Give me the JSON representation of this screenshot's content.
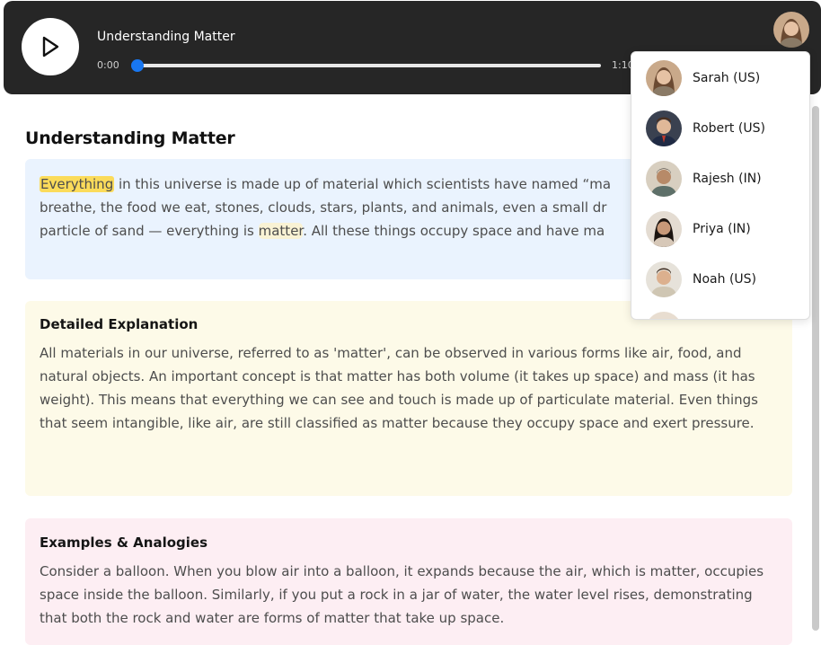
{
  "player": {
    "title": "Understanding Matter",
    "time_current": "0:00",
    "time_total": "1:10",
    "progress": 0
  },
  "page": {
    "title": "Understanding Matter"
  },
  "intro": {
    "highlighted_word": "Everything",
    "line1_rest": " in this universe is made up of material which scientists have named “ma",
    "line2": "breathe, the food we eat, stones, clouds, stars, plants, and animals, even a small dr",
    "line3_a": "particle of sand — everything is ",
    "line3_word": "matter",
    "line3_b": ". All these things occupy space and have ma"
  },
  "detail": {
    "heading": "Detailed Explanation",
    "body": "All materials in our universe, referred to as 'matter', can be observed in various forms like air, food, and natural objects. An important concept is that matter has both volume (it takes up space) and mass (it has weight). This means that everything we can see and touch is made up of particulate material. Even things that seem intangible, like air, are still classified as matter because they occupy space and exert pressure."
  },
  "examples": {
    "heading": "Examples & Analogies",
    "body": "Consider a balloon. When you blow air into a balloon, it expands because the air, which is matter, occupies space inside the balloon. Similarly, if you put a rock in a jar of water, the water level rises, demonstrating that both the rock and water are forms of matter that take up space."
  },
  "voices": [
    {
      "name": "Sarah (US)",
      "icon": "avatar-sarah-icon"
    },
    {
      "name": "Robert (US)",
      "icon": "avatar-robert-icon"
    },
    {
      "name": "Rajesh (IN)",
      "icon": "avatar-rajesh-icon"
    },
    {
      "name": "Priya (IN)",
      "icon": "avatar-priya-icon"
    },
    {
      "name": "Noah (US)",
      "icon": "avatar-noah-icon"
    }
  ],
  "colors": {
    "player_bg": "#262626",
    "accent": "#1877f2",
    "highlight": "#fbdb5a",
    "intro_bg": "#eaf3fe",
    "detail_bg": "#fdfae8",
    "examples_bg": "#fdeef3"
  }
}
